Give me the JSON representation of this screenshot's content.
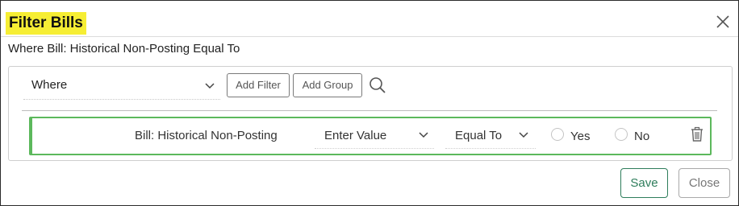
{
  "dialog": {
    "title": "Filter Bills",
    "subtitle": "Where Bill: Historical Non-Posting Equal To",
    "close_icon": "close-icon"
  },
  "toolbar": {
    "where_value": "Where",
    "add_filter_label": "Add Filter",
    "add_group_label": "Add Group",
    "search_icon": "search-icon"
  },
  "filter_row": {
    "field_label": "Bill: Historical Non-Posting",
    "value_placeholder": "Enter Value",
    "operator_value": "Equal To",
    "options": [
      {
        "label": "Yes",
        "selected": false
      },
      {
        "label": "No",
        "selected": false
      }
    ],
    "delete_icon": "trash-icon",
    "accent_color": "#5cb85c"
  },
  "footer": {
    "save_label": "Save",
    "close_label": "Close"
  },
  "colors": {
    "title_highlight": "#f6ee34",
    "save_accent": "#2e7d5b"
  }
}
